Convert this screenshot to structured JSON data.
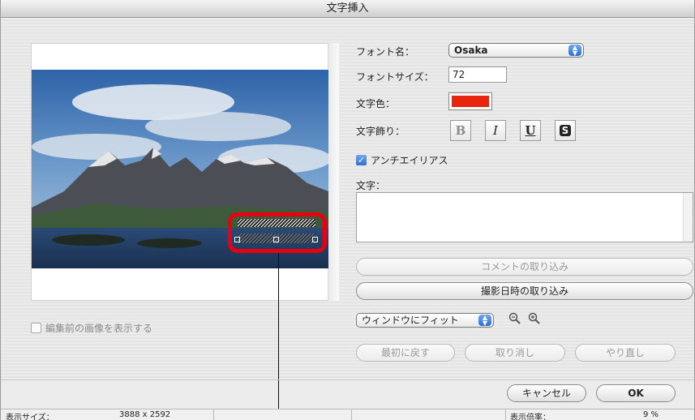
{
  "window": {
    "title": "文字挿入"
  },
  "preview": {
    "show_original_label": "編集前の画像を表示する"
  },
  "form": {
    "font_name_label": "フォント名：",
    "font_name_value": "Osaka",
    "font_size_label": "フォントサイズ：",
    "font_size_value": "72",
    "text_color_label": "文字色：",
    "text_color_value": "#e8260e",
    "decoration_label": "文字飾り：",
    "bold": "B",
    "italic": "I",
    "underline": "U",
    "shadow": "S",
    "antialias_label": "アンチエイリアス",
    "text_label": "文字："
  },
  "buttons": {
    "import_comment": "コメントの取り込み",
    "import_datetime": "撮影日時の取り込み",
    "revert": "最初に戻す",
    "undo": "取り消し",
    "redo": "やり直し",
    "cancel": "キャンセル",
    "ok": "OK"
  },
  "zoom": {
    "selected": "ウィンドウにフィット"
  },
  "status": {
    "display_size_label": "表示サイズ：",
    "display_size_value": "3888 x 2592",
    "zoom_rate_label": "表示倍率：",
    "zoom_rate_value": "9 %"
  }
}
